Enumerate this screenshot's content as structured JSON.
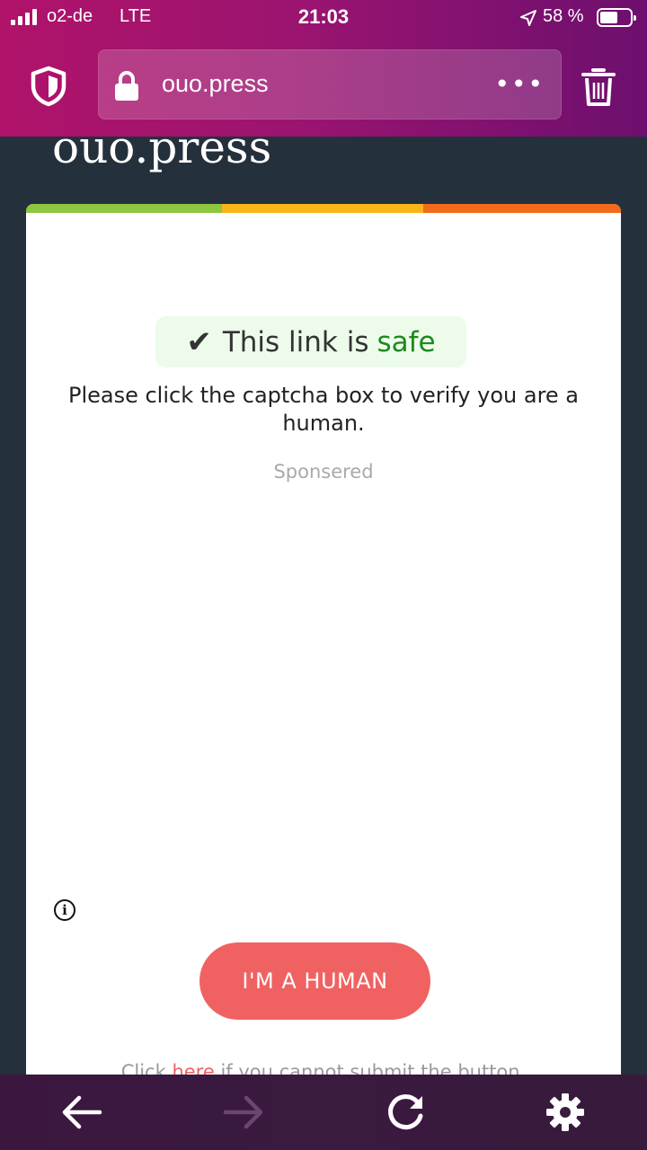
{
  "status_bar": {
    "carrier": "o2-de",
    "network": "LTE",
    "time": "21:03",
    "battery_percent": "58 %",
    "battery_level": 0.58,
    "icons": [
      "signal-icon",
      "location-arrow-icon",
      "battery-icon"
    ]
  },
  "browser": {
    "url": "ouo.press",
    "more_label": "•••",
    "icons": [
      "shield-icon",
      "lock-icon",
      "more-icon",
      "trash-icon"
    ]
  },
  "page": {
    "site_title": "ouo.press",
    "stripe_colors": [
      "#8dc63f",
      "#f7b51a",
      "#f26a1b"
    ],
    "safe_badge": {
      "check": "✔",
      "prefix": "This link is",
      "highlight": "safe",
      "highlight_color": "#1c8a1c"
    },
    "verify_text": "Please click the captcha box to verify you are a human.",
    "sponsored_label": "Sponsered",
    "info_label": "i",
    "human_button_label": "I'M A HUMAN",
    "click_here": {
      "before": "Click ",
      "link": "here",
      "after": " if you cannot submit the button."
    },
    "accent_color": "#f06262"
  },
  "toolbar": {
    "icons": [
      "back-arrow-icon",
      "forward-arrow-icon",
      "reload-icon",
      "settings-gear-icon"
    ]
  }
}
